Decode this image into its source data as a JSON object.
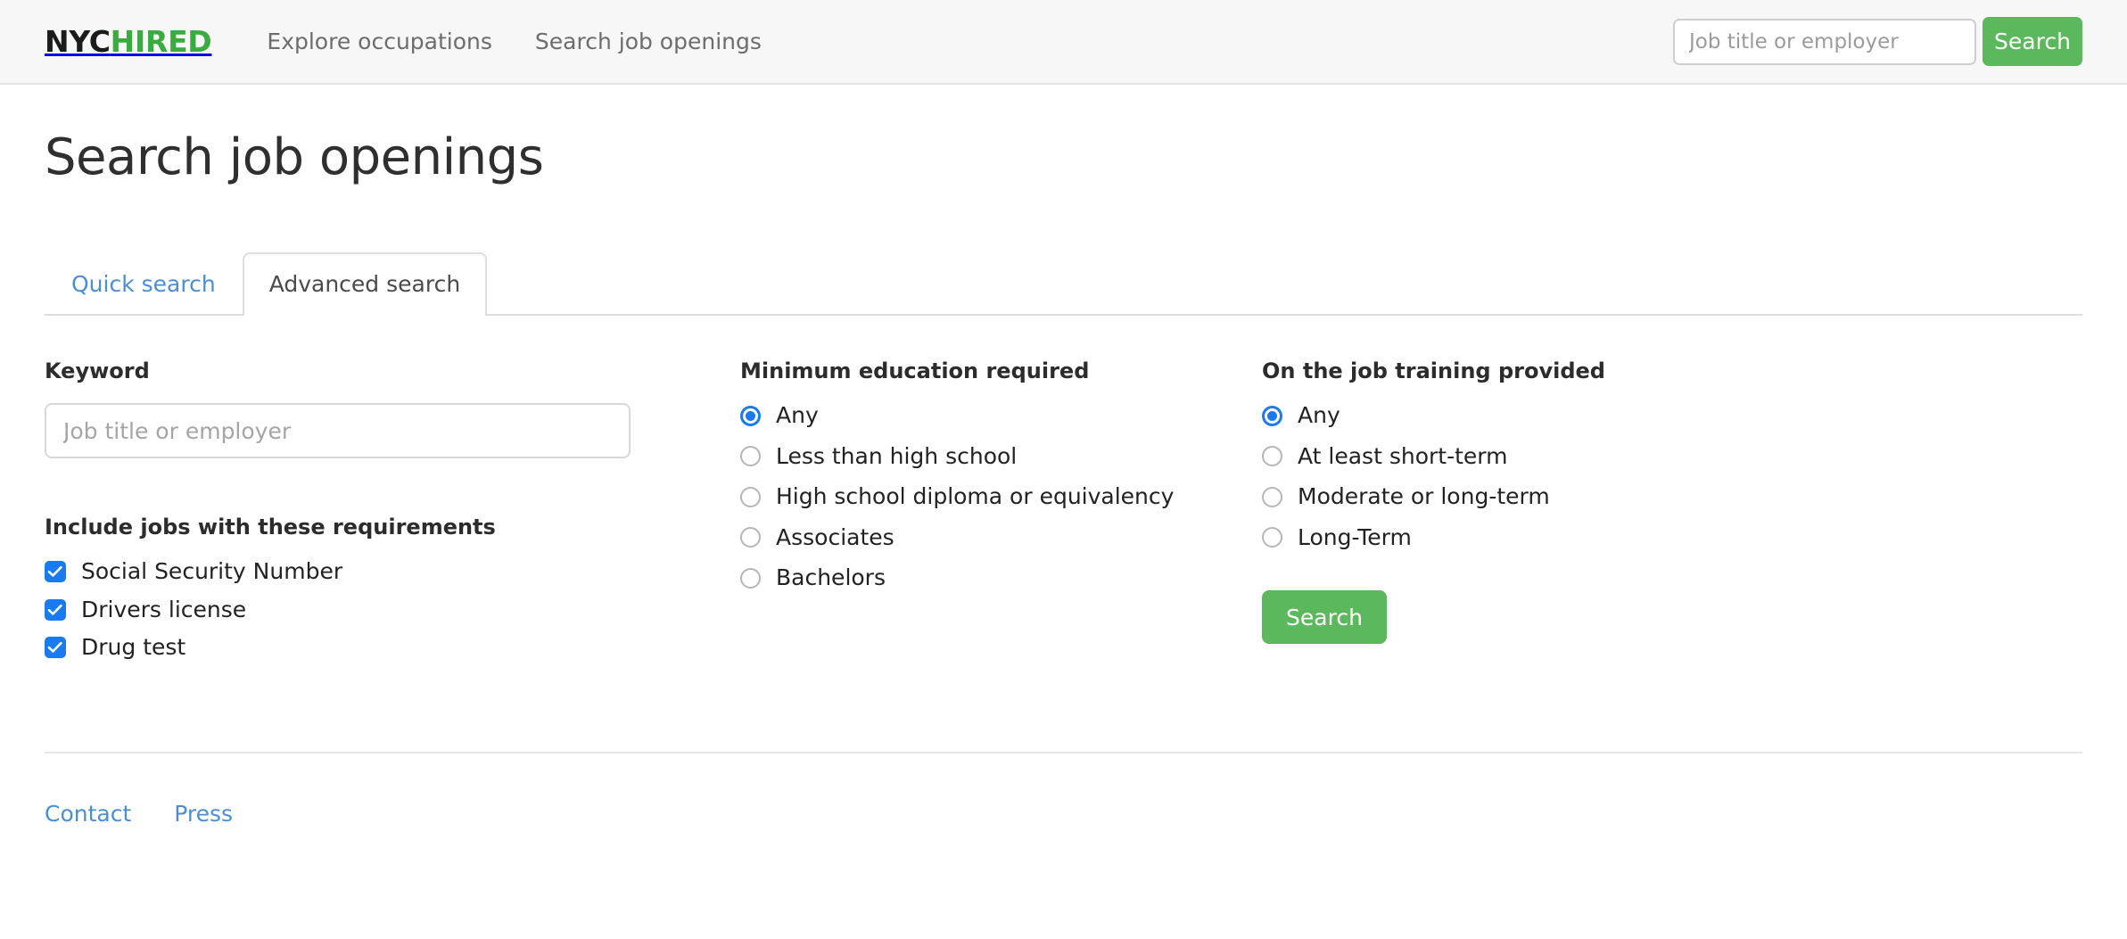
{
  "header": {
    "brand": {
      "part1": "NYC",
      "part2": "HIRED"
    },
    "nav": [
      {
        "label": "Explore occupations",
        "name": "nav-link-explore-occupations"
      },
      {
        "label": "Search job openings",
        "name": "nav-link-search-job-openings"
      }
    ],
    "search": {
      "placeholder": "Job title or employer",
      "value": "",
      "button_label": "Search"
    }
  },
  "page": {
    "title": "Search job openings"
  },
  "tabs": [
    {
      "label": "Quick search",
      "active": false
    },
    {
      "label": "Advanced search",
      "active": true
    }
  ],
  "form": {
    "keyword": {
      "label": "Keyword",
      "placeholder": "Job title or employer",
      "value": ""
    },
    "requirements": {
      "label": "Include jobs with these requirements",
      "items": [
        {
          "label": "Social Security Number",
          "checked": true
        },
        {
          "label": "Drivers license",
          "checked": true
        },
        {
          "label": "Drug test",
          "checked": true
        }
      ]
    },
    "education": {
      "label": "Minimum education required",
      "selected": "Any",
      "options": [
        {
          "label": "Any",
          "checked": true
        },
        {
          "label": "Less than high school",
          "checked": false
        },
        {
          "label": "High school diploma or equivalency",
          "checked": false
        },
        {
          "label": "Associates",
          "checked": false
        },
        {
          "label": "Bachelors",
          "checked": false
        }
      ]
    },
    "training": {
      "label": "On the job training provided",
      "selected": "Any",
      "options": [
        {
          "label": "Any",
          "checked": true
        },
        {
          "label": "At least short-term",
          "checked": false
        },
        {
          "label": "Moderate or long-term",
          "checked": false
        },
        {
          "label": "Long-Term",
          "checked": false
        }
      ]
    },
    "submit_label": "Search"
  },
  "footer": {
    "links": [
      {
        "label": "Contact"
      },
      {
        "label": "Press"
      }
    ]
  },
  "colors": {
    "brand_green": "#3aab3f",
    "button_green": "#5cb85c",
    "link_blue": "#4a8fd4",
    "control_blue": "#1a7af0",
    "header_bg": "#f7f7f7"
  }
}
